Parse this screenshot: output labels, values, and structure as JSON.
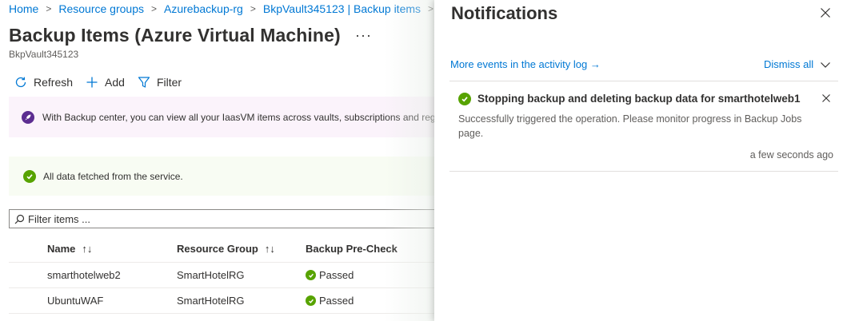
{
  "breadcrumb": {
    "items": [
      "Home",
      "Resource groups",
      "Azurebackup-rg",
      "BkpVault345123 | Backup items"
    ],
    "separator": ">"
  },
  "page": {
    "title": "Backup Items (Azure Virtual Machine)",
    "more": "···",
    "subtitle": "BkpVault345123"
  },
  "toolbar": {
    "refresh_label": "Refresh",
    "add_label": "Add",
    "filter_label": "Filter"
  },
  "info_banner": {
    "text": "With Backup center, you can view all your IaasVM items across vaults, subscriptions and regions."
  },
  "success_banner": {
    "text": "All data fetched from the service."
  },
  "filter": {
    "placeholder": "Filter items ..."
  },
  "grid": {
    "columns": [
      "Name",
      "Resource Group",
      "Backup Pre-Check"
    ],
    "sort_glyph": "↑↓",
    "rows": [
      {
        "name": "smarthotelweb2",
        "resource_group": "SmartHotelRG",
        "pre_check": "Passed"
      },
      {
        "name": "UbuntuWAF",
        "resource_group": "SmartHotelRG",
        "pre_check": "Passed"
      }
    ]
  },
  "notifications": {
    "title": "Notifications",
    "activity_log_link": "More events in the activity log →",
    "dismiss_all": "Dismiss all",
    "items": [
      {
        "title": "Stopping backup and deleting backup data for smarthotelweb1",
        "body": "Successfully triggered the operation. Please monitor progress in Backup Jobs page.",
        "time": "a few seconds ago",
        "status": "success"
      }
    ]
  },
  "colors": {
    "link": "#0078d4",
    "success": "#57a300",
    "info_icon": "#5c2d91",
    "info_banner_bg": "#fbf3fb",
    "success_banner_bg": "#f8fcf3"
  },
  "icons": {
    "refresh": "refresh-icon",
    "add": "add-icon",
    "filter": "filter-icon",
    "search": "search-icon",
    "close": "close-icon",
    "chevron": "chevron-down-icon",
    "success": "checkmark-circle-icon",
    "backup_center": "rocket-icon"
  }
}
